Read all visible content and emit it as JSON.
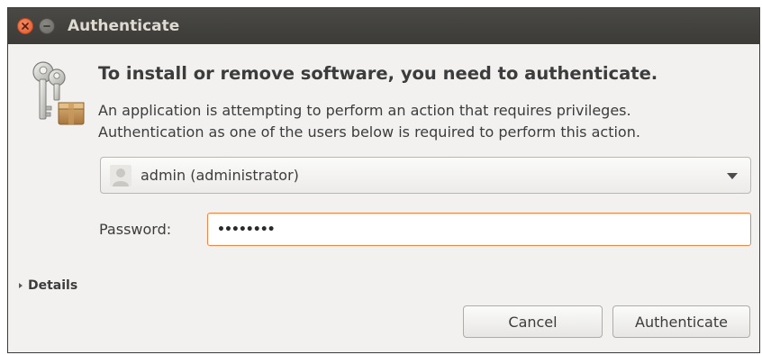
{
  "window": {
    "title": "Authenticate"
  },
  "dialog": {
    "heading": "To install or remove software, you need to authenticate.",
    "description_line1": "An application is attempting to perform an action that requires privileges.",
    "description_line2": "Authentication as one of the users below is required to perform this action.",
    "user_select": {
      "selected": "admin (administrator)"
    },
    "password": {
      "label": "Password:",
      "value": "••••••••"
    },
    "details_label": "Details",
    "buttons": {
      "cancel": "Cancel",
      "authenticate": "Authenticate"
    }
  },
  "colors": {
    "titlebar": "#3c3b37",
    "close_button": "#e05b2a",
    "focus_border": "#e5884b",
    "window_bg": "#f2f1f0"
  },
  "icons": {
    "close": "close-icon",
    "minimize": "minimize-icon",
    "dialog": "keys-package-icon",
    "user": "user-avatar-icon",
    "dropdown": "chevron-down-icon",
    "details": "expander-arrow-icon"
  }
}
